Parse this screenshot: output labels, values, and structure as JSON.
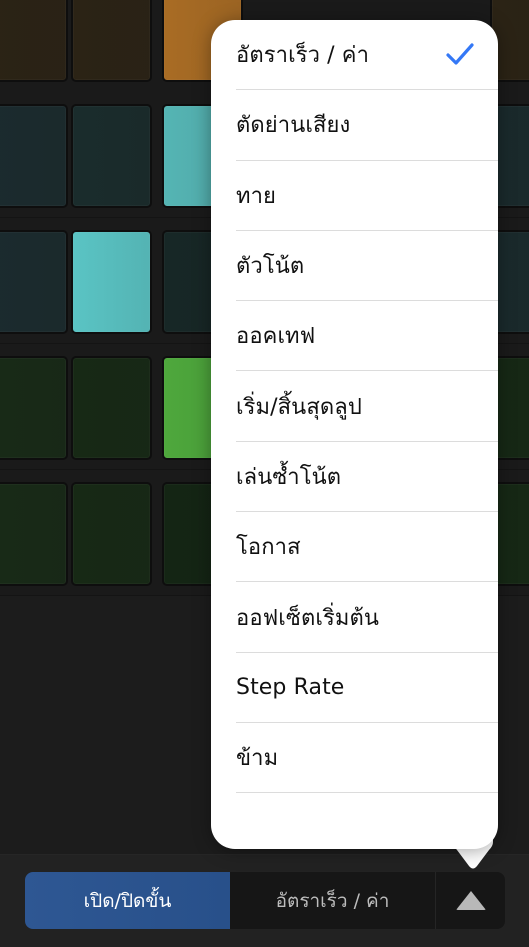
{
  "grid": {
    "rows": [
      {
        "base_color": "#2a2214",
        "cells": [
          {
            "col": 1,
            "active": false,
            "color": "#2b2315"
          },
          {
            "col": 2,
            "active": false,
            "color": "#2b2315"
          },
          {
            "col": 3,
            "active": true,
            "color": "#a96c24"
          },
          {
            "col": 4,
            "active": false,
            "color": "#2b2315"
          }
        ]
      },
      {
        "base_color": "#1a2a2c",
        "cells": [
          {
            "col": 1,
            "active": false,
            "color": "#1b2b2e"
          },
          {
            "col": 2,
            "active": false,
            "color": "#1a2c2c"
          },
          {
            "col": 3,
            "active": true,
            "color": "#55b5b4"
          },
          {
            "col": 4,
            "active": false,
            "color": "#1a2a2c"
          }
        ]
      },
      {
        "base_color": "#1a2a2c",
        "cells": [
          {
            "col": 1,
            "active": false,
            "color": "#1b2b2e"
          },
          {
            "col": 2,
            "active": true,
            "color": "#5ac4c4"
          },
          {
            "col": 3,
            "active": false,
            "color": "#172726"
          },
          {
            "col": 4,
            "active": false,
            "color": "#1a2a2c"
          }
        ]
      },
      {
        "base_color": "#182a17",
        "cells": [
          {
            "col": 1,
            "active": false,
            "color": "#182a17"
          },
          {
            "col": 2,
            "active": false,
            "color": "#172915"
          },
          {
            "col": 3,
            "active": true,
            "color": "#4ea83c"
          },
          {
            "col": 4,
            "active": false,
            "color": "#162815"
          }
        ]
      },
      {
        "base_color": "#182a17",
        "cells": [
          {
            "col": 1,
            "active": false,
            "color": "#182a17"
          },
          {
            "col": 2,
            "active": false,
            "color": "#172915"
          },
          {
            "col": 3,
            "active": false,
            "color": "#142514"
          },
          {
            "col": 4,
            "active": false,
            "color": "#162815"
          }
        ]
      }
    ]
  },
  "menu": {
    "items": [
      {
        "label": "อัตราเร็ว / ค่า",
        "selected": true
      },
      {
        "label": "ตัดย่านเสียง",
        "selected": false
      },
      {
        "label": "ทาย",
        "selected": false
      },
      {
        "label": "ตัวโน้ต",
        "selected": false
      },
      {
        "label": "ออคเทฟ",
        "selected": false
      },
      {
        "label": "เริ่ม/สิ้นสุดลูป",
        "selected": false
      },
      {
        "label": "เล่นซ้ำโน้ต",
        "selected": false
      },
      {
        "label": "โอกาส",
        "selected": false
      },
      {
        "label": "ออฟเซ็ตเริ่มต้น",
        "selected": false
      },
      {
        "label": "Step Rate",
        "selected": false
      },
      {
        "label": "ข้าม",
        "selected": false
      }
    ],
    "check_icon": "checkmark-icon",
    "check_color": "#3478f6"
  },
  "toolbar": {
    "segments": [
      {
        "label": "เปิด/ปิดขั้น",
        "active": true
      },
      {
        "label": "อัตราเร็ว / ค่า",
        "active": false
      },
      {
        "label": "",
        "icon": "triangle-up-icon",
        "active": false
      }
    ],
    "active_color": "#2d5690"
  }
}
